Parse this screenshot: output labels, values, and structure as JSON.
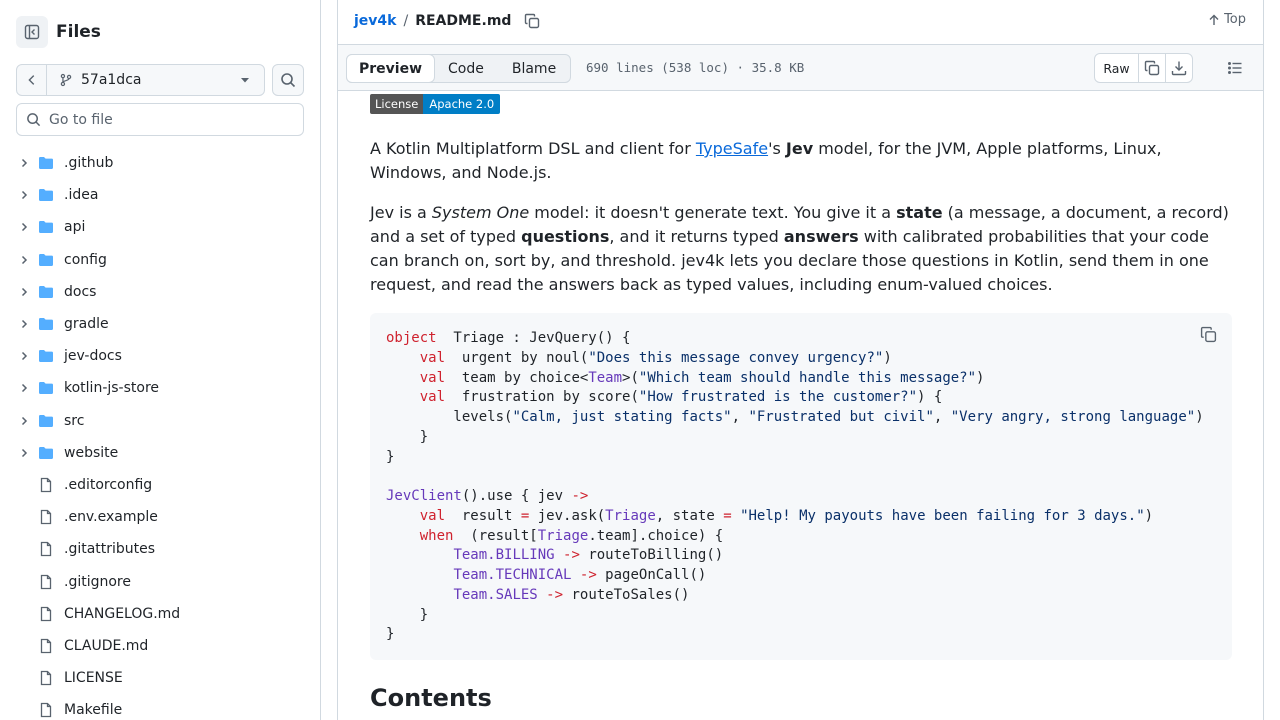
{
  "sidebar": {
    "title": "Files",
    "branch": "57a1dca",
    "goto_placeholder": "Go to file",
    "items": [
      {
        "name": ".github",
        "type": "folder"
      },
      {
        "name": ".idea",
        "type": "folder"
      },
      {
        "name": "api",
        "type": "folder"
      },
      {
        "name": "config",
        "type": "folder"
      },
      {
        "name": "docs",
        "type": "folder"
      },
      {
        "name": "gradle",
        "type": "folder"
      },
      {
        "name": "jev-docs",
        "type": "folder"
      },
      {
        "name": "kotlin-js-store",
        "type": "folder"
      },
      {
        "name": "src",
        "type": "folder"
      },
      {
        "name": "website",
        "type": "folder"
      },
      {
        "name": ".editorconfig",
        "type": "file"
      },
      {
        "name": ".env.example",
        "type": "file"
      },
      {
        "name": ".gitattributes",
        "type": "file"
      },
      {
        "name": ".gitignore",
        "type": "file"
      },
      {
        "name": "CHANGELOG.md",
        "type": "file"
      },
      {
        "name": "CLAUDE.md",
        "type": "file"
      },
      {
        "name": "LICENSE",
        "type": "file"
      },
      {
        "name": "Makefile",
        "type": "file"
      }
    ]
  },
  "header": {
    "repo": "jev4k",
    "separator": "/",
    "file": "README.md",
    "top_label": "Top"
  },
  "filebar": {
    "tabs": [
      "Preview",
      "Code",
      "Blame"
    ],
    "active_tab": "Preview",
    "meta": "690 lines (538 loc) · 35.8 KB",
    "raw_label": "Raw"
  },
  "readme": {
    "badge_left": "License",
    "badge_right": "Apache 2.0",
    "p1": {
      "a": "A Kotlin Multiplatform DSL and client for ",
      "link": "TypeSafe",
      "b": "'s ",
      "bold": "Jev",
      "c": " model, for the JVM, Apple platforms, Linux, Windows, and Node.js."
    },
    "p2": {
      "a": "Jev is a ",
      "italic": "System One",
      "b": " model: it doesn't generate text. You give it a ",
      "bold1": "state",
      "c": " (a message, a document, a record) and a set of typed ",
      "bold2": "questions",
      "d": ", and it returns typed ",
      "bold3": "answers",
      "e": " with calibrated probabilities that your code can branch on, sort by, and threshold. jev4k lets you declare those questions in Kotlin, send them in one request, and read the answers back as typed values, including enum-valued choices."
    },
    "code": [
      [
        [
          "kw",
          "object"
        ],
        [
          "",
          "  Triage : JevQuery() {"
        ]
      ],
      [
        [
          "",
          "    "
        ],
        [
          "kw",
          "val"
        ],
        [
          "",
          ""
        ],
        [
          "",
          "  urgent by noul("
        ],
        [
          "st",
          "\"Does this message convey urgency?\""
        ],
        [
          "",
          ")"
        ]
      ],
      [
        [
          "",
          "    "
        ],
        [
          "kw",
          "val"
        ],
        [
          "",
          "  team by choice<"
        ],
        [
          "ty",
          "Team"
        ],
        [
          "",
          ">("
        ],
        [
          "st",
          "\"Which team should handle this message?\""
        ],
        [
          "",
          ")"
        ]
      ],
      [
        [
          "",
          "    "
        ],
        [
          "kw",
          "val"
        ],
        [
          "",
          "  frustration by score("
        ],
        [
          "st",
          "\"How frustrated is the customer?\""
        ],
        [
          "",
          ") {"
        ]
      ],
      [
        [
          "",
          "        levels("
        ],
        [
          "st",
          "\"Calm, just stating facts\""
        ],
        [
          "",
          ", "
        ],
        [
          "st",
          "\"Frustrated but civil\""
        ],
        [
          "",
          ", "
        ],
        [
          "st",
          "\"Very angry, strong language\""
        ],
        [
          "",
          ")"
        ]
      ],
      [
        [
          "",
          "    }"
        ]
      ],
      [
        [
          "",
          "}"
        ]
      ],
      [
        [
          "",
          ""
        ]
      ],
      [
        [
          "ty",
          "JevClient"
        ],
        [
          "",
          "().use { jev "
        ],
        [
          "kw",
          "->"
        ]
      ],
      [
        [
          "",
          "    "
        ],
        [
          "kw",
          "val"
        ],
        [
          "",
          "  result "
        ],
        [
          "kw",
          "="
        ],
        [
          "",
          ""
        ],
        [
          "",
          " jev.ask("
        ],
        [
          "ty",
          "Triage"
        ],
        [
          "",
          ", state "
        ],
        [
          "kw",
          "="
        ],
        [
          "",
          ""
        ],
        [
          "",
          " "
        ],
        [
          "st",
          "\"Help! My payouts have been failing for 3 days.\""
        ],
        [
          "",
          ")"
        ]
      ],
      [
        [
          "",
          "    "
        ],
        [
          "kw",
          "when"
        ],
        [
          "",
          "  (result["
        ],
        [
          "ty",
          "Triage"
        ],
        [
          "",
          ".team].choice) {"
        ]
      ],
      [
        [
          "",
          "        "
        ],
        [
          "ty",
          "Team"
        ],
        [
          "",
          ""
        ],
        [
          "ty",
          ".BILLING"
        ],
        [
          "",
          " "
        ],
        [
          "kw",
          "->"
        ],
        [
          "",
          " routeToBilling()"
        ]
      ],
      [
        [
          "",
          "        "
        ],
        [
          "ty",
          "Team"
        ],
        [
          "",
          ""
        ],
        [
          "ty",
          ".TECHNICAL"
        ],
        [
          "",
          " "
        ],
        [
          "kw",
          "->"
        ],
        [
          "",
          " pageOnCall()"
        ]
      ],
      [
        [
          "",
          "        "
        ],
        [
          "ty",
          "Team"
        ],
        [
          "",
          ""
        ],
        [
          "ty",
          ".SALES"
        ],
        [
          "",
          " "
        ],
        [
          "kw",
          "->"
        ],
        [
          "",
          " routeToSales()"
        ]
      ],
      [
        [
          "",
          "    }"
        ]
      ],
      [
        [
          "",
          "}"
        ]
      ]
    ],
    "h2": "Contents"
  }
}
